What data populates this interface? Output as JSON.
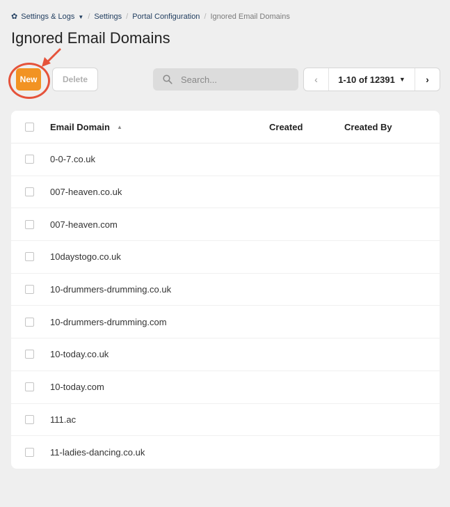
{
  "breadcrumb": {
    "items": [
      {
        "label": "Settings & Logs",
        "has_dropdown": true
      },
      {
        "label": "Settings"
      },
      {
        "label": "Portal Configuration"
      }
    ],
    "current": "Ignored Email Domains"
  },
  "page": {
    "title": "Ignored Email Domains"
  },
  "toolbar": {
    "new_label": "New",
    "delete_label": "Delete",
    "search_placeholder": "Search...",
    "pagination_label": "1-10 of 12391"
  },
  "table": {
    "columns": [
      "Email Domain",
      "Created",
      "Created By"
    ],
    "sorted_column": "Email Domain",
    "sort_direction": "ascending",
    "rows": [
      {
        "domain": "0-0-7.co.uk",
        "created": "",
        "created_by": ""
      },
      {
        "domain": "007-heaven.co.uk",
        "created": "",
        "created_by": ""
      },
      {
        "domain": "007-heaven.com",
        "created": "",
        "created_by": ""
      },
      {
        "domain": "10daystogo.co.uk",
        "created": "",
        "created_by": ""
      },
      {
        "domain": "10-drummers-drumming.co.uk",
        "created": "",
        "created_by": ""
      },
      {
        "domain": "10-drummers-drumming.com",
        "created": "",
        "created_by": ""
      },
      {
        "domain": "10-today.co.uk",
        "created": "",
        "created_by": ""
      },
      {
        "domain": "10-today.com",
        "created": "",
        "created_by": ""
      },
      {
        "domain": "111.ac",
        "created": "",
        "created_by": ""
      },
      {
        "domain": "11-ladies-dancing.co.uk",
        "created": "",
        "created_by": ""
      }
    ]
  },
  "colors": {
    "accent": "#f29323",
    "annotation": "#e5533b",
    "link": "#1f3c5e",
    "background": "#efefef"
  },
  "icons": [
    "gear-icon",
    "caret-down-icon",
    "search-icon",
    "chevron-left-icon",
    "chevron-right-icon",
    "sort-ascending-icon"
  ]
}
